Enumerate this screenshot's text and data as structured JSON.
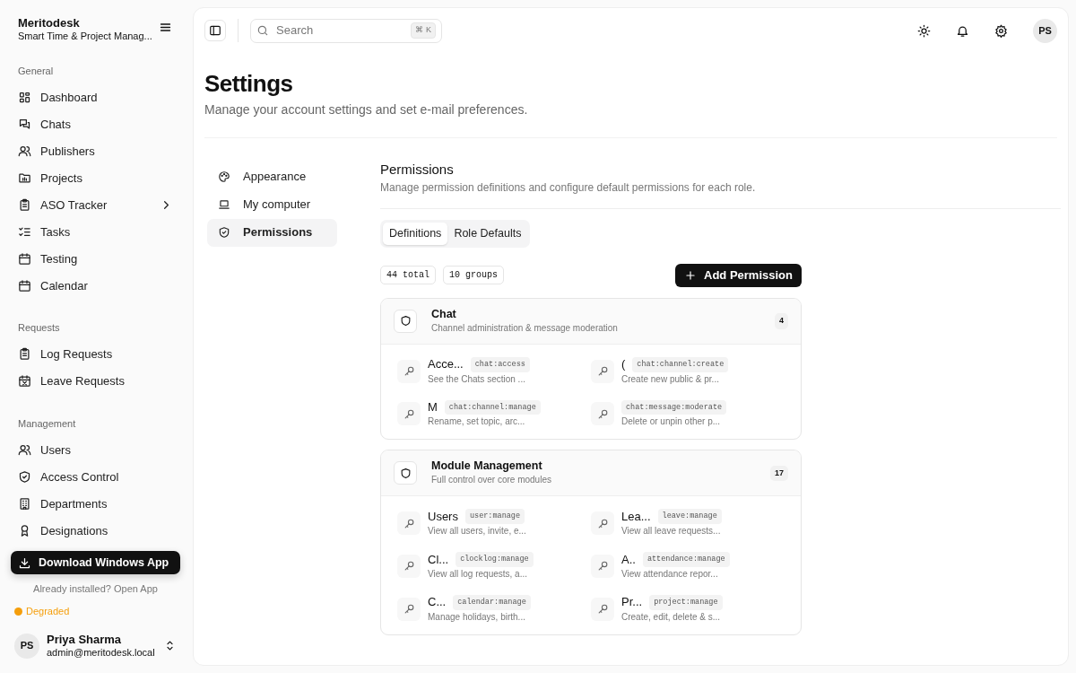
{
  "sidebar": {
    "brand": "Meritodesk",
    "subtitle": "Smart Time & Project Manag...",
    "sections": [
      {
        "title": "General",
        "items": [
          {
            "label": "Dashboard"
          },
          {
            "label": "Chats"
          },
          {
            "label": "Publishers"
          },
          {
            "label": "Projects"
          },
          {
            "label": "ASO Tracker",
            "has_submenu": true
          },
          {
            "label": "Tasks"
          },
          {
            "label": "Testing"
          },
          {
            "label": "Calendar"
          }
        ]
      },
      {
        "title": "Requests",
        "items": [
          {
            "label": "Log Requests"
          },
          {
            "label": "Leave Requests"
          }
        ]
      },
      {
        "title": "Management",
        "items": [
          {
            "label": "Users"
          },
          {
            "label": "Access Control"
          },
          {
            "label": "Departments"
          },
          {
            "label": "Designations"
          }
        ]
      }
    ],
    "download_button": "Download Windows App",
    "install_note": "Already installed? Open App",
    "status": {
      "label": "Degraded",
      "color": "#f59e0b"
    },
    "user": {
      "initials": "PS",
      "name": "Priya Sharma",
      "email": "admin@meritodesk.local"
    }
  },
  "topbar": {
    "search": {
      "placeholder": "Search",
      "shortcut": "⌘",
      "shortcut_key": "K"
    },
    "avatar": "PS"
  },
  "page": {
    "title": "Settings",
    "subtitle": "Manage your account settings and set e-mail preferences."
  },
  "settings_nav": [
    {
      "label": "Appearance",
      "selected": false
    },
    {
      "label": "My computer",
      "selected": false
    },
    {
      "label": "Permissions",
      "selected": true
    }
  ],
  "permissions": {
    "title": "Permissions",
    "subtitle": "Manage permission definitions and configure default permissions for each role.",
    "tabs": [
      {
        "label": "Definitions",
        "selected": true
      },
      {
        "label": "Role Defaults",
        "selected": false
      }
    ],
    "counts": [
      "44 total",
      "10 groups"
    ],
    "add_button": "Add Permission",
    "groups": [
      {
        "title": "Chat",
        "description": "Channel administration & message moderation",
        "count": "4",
        "permissions": [
          {
            "name": "Acce...",
            "code": "chat:access",
            "description": "See the Chats section ..."
          },
          {
            "name": "(",
            "code": "chat:channel:create",
            "description": "Create new public & pr..."
          },
          {
            "name": "M",
            "code": "chat:channel:manage",
            "description": "Rename, set topic, arc..."
          },
          {
            "code": "chat:message:moderate",
            "description": "Delete or unpin other p..."
          }
        ]
      },
      {
        "title": "Module Management",
        "description": "Full control over core modules",
        "count": "17",
        "permissions": [
          {
            "name": "Users",
            "code": "user:manage",
            "description": "View all users, invite, e..."
          },
          {
            "name": "Lea...",
            "code": "leave:manage",
            "description": "View all leave requests..."
          },
          {
            "name": "Cl...",
            "code": "clocklog:manage",
            "description": "View all log requests, a..."
          },
          {
            "name": "A..",
            "code": "attendance:manage",
            "description": "View attendance repor..."
          },
          {
            "name": "C...",
            "code": "calendar:manage",
            "description": "Manage holidays, birth..."
          },
          {
            "name": "Pr...",
            "code": "project:manage",
            "description": "Create, edit, delete & s..."
          }
        ]
      }
    ]
  }
}
